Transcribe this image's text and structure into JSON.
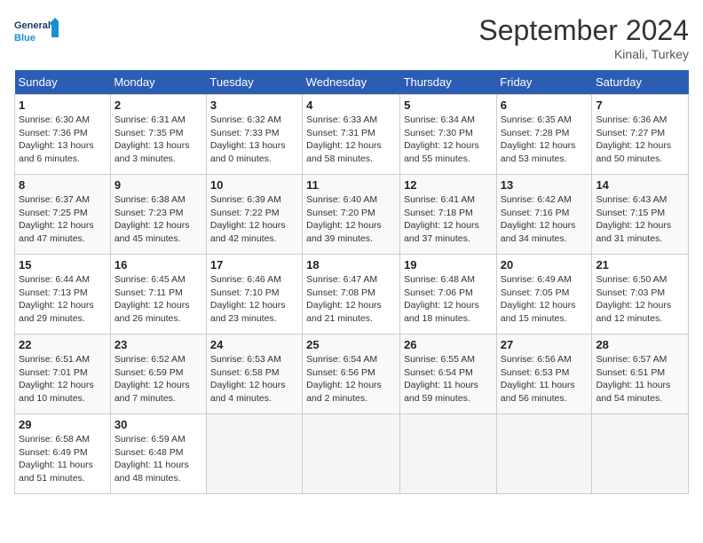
{
  "header": {
    "logo_general": "General",
    "logo_blue": "Blue",
    "month_title": "September 2024",
    "location": "Kinali, Turkey"
  },
  "columns": [
    "Sunday",
    "Monday",
    "Tuesday",
    "Wednesday",
    "Thursday",
    "Friday",
    "Saturday"
  ],
  "weeks": [
    [
      {
        "day": "1",
        "info": "Sunrise: 6:30 AM\nSunset: 7:36 PM\nDaylight: 13 hours\nand 6 minutes."
      },
      {
        "day": "2",
        "info": "Sunrise: 6:31 AM\nSunset: 7:35 PM\nDaylight: 13 hours\nand 3 minutes."
      },
      {
        "day": "3",
        "info": "Sunrise: 6:32 AM\nSunset: 7:33 PM\nDaylight: 13 hours\nand 0 minutes."
      },
      {
        "day": "4",
        "info": "Sunrise: 6:33 AM\nSunset: 7:31 PM\nDaylight: 12 hours\nand 58 minutes."
      },
      {
        "day": "5",
        "info": "Sunrise: 6:34 AM\nSunset: 7:30 PM\nDaylight: 12 hours\nand 55 minutes."
      },
      {
        "day": "6",
        "info": "Sunrise: 6:35 AM\nSunset: 7:28 PM\nDaylight: 12 hours\nand 53 minutes."
      },
      {
        "day": "7",
        "info": "Sunrise: 6:36 AM\nSunset: 7:27 PM\nDaylight: 12 hours\nand 50 minutes."
      }
    ],
    [
      {
        "day": "8",
        "info": "Sunrise: 6:37 AM\nSunset: 7:25 PM\nDaylight: 12 hours\nand 47 minutes."
      },
      {
        "day": "9",
        "info": "Sunrise: 6:38 AM\nSunset: 7:23 PM\nDaylight: 12 hours\nand 45 minutes."
      },
      {
        "day": "10",
        "info": "Sunrise: 6:39 AM\nSunset: 7:22 PM\nDaylight: 12 hours\nand 42 minutes."
      },
      {
        "day": "11",
        "info": "Sunrise: 6:40 AM\nSunset: 7:20 PM\nDaylight: 12 hours\nand 39 minutes."
      },
      {
        "day": "12",
        "info": "Sunrise: 6:41 AM\nSunset: 7:18 PM\nDaylight: 12 hours\nand 37 minutes."
      },
      {
        "day": "13",
        "info": "Sunrise: 6:42 AM\nSunset: 7:16 PM\nDaylight: 12 hours\nand 34 minutes."
      },
      {
        "day": "14",
        "info": "Sunrise: 6:43 AM\nSunset: 7:15 PM\nDaylight: 12 hours\nand 31 minutes."
      }
    ],
    [
      {
        "day": "15",
        "info": "Sunrise: 6:44 AM\nSunset: 7:13 PM\nDaylight: 12 hours\nand 29 minutes."
      },
      {
        "day": "16",
        "info": "Sunrise: 6:45 AM\nSunset: 7:11 PM\nDaylight: 12 hours\nand 26 minutes."
      },
      {
        "day": "17",
        "info": "Sunrise: 6:46 AM\nSunset: 7:10 PM\nDaylight: 12 hours\nand 23 minutes."
      },
      {
        "day": "18",
        "info": "Sunrise: 6:47 AM\nSunset: 7:08 PM\nDaylight: 12 hours\nand 21 minutes."
      },
      {
        "day": "19",
        "info": "Sunrise: 6:48 AM\nSunset: 7:06 PM\nDaylight: 12 hours\nand 18 minutes."
      },
      {
        "day": "20",
        "info": "Sunrise: 6:49 AM\nSunset: 7:05 PM\nDaylight: 12 hours\nand 15 minutes."
      },
      {
        "day": "21",
        "info": "Sunrise: 6:50 AM\nSunset: 7:03 PM\nDaylight: 12 hours\nand 12 minutes."
      }
    ],
    [
      {
        "day": "22",
        "info": "Sunrise: 6:51 AM\nSunset: 7:01 PM\nDaylight: 12 hours\nand 10 minutes."
      },
      {
        "day": "23",
        "info": "Sunrise: 6:52 AM\nSunset: 6:59 PM\nDaylight: 12 hours\nand 7 minutes."
      },
      {
        "day": "24",
        "info": "Sunrise: 6:53 AM\nSunset: 6:58 PM\nDaylight: 12 hours\nand 4 minutes."
      },
      {
        "day": "25",
        "info": "Sunrise: 6:54 AM\nSunset: 6:56 PM\nDaylight: 12 hours\nand 2 minutes."
      },
      {
        "day": "26",
        "info": "Sunrise: 6:55 AM\nSunset: 6:54 PM\nDaylight: 11 hours\nand 59 minutes."
      },
      {
        "day": "27",
        "info": "Sunrise: 6:56 AM\nSunset: 6:53 PM\nDaylight: 11 hours\nand 56 minutes."
      },
      {
        "day": "28",
        "info": "Sunrise: 6:57 AM\nSunset: 6:51 PM\nDaylight: 11 hours\nand 54 minutes."
      }
    ],
    [
      {
        "day": "29",
        "info": "Sunrise: 6:58 AM\nSunset: 6:49 PM\nDaylight: 11 hours\nand 51 minutes."
      },
      {
        "day": "30",
        "info": "Sunrise: 6:59 AM\nSunset: 6:48 PM\nDaylight: 11 hours\nand 48 minutes."
      },
      null,
      null,
      null,
      null,
      null
    ]
  ]
}
